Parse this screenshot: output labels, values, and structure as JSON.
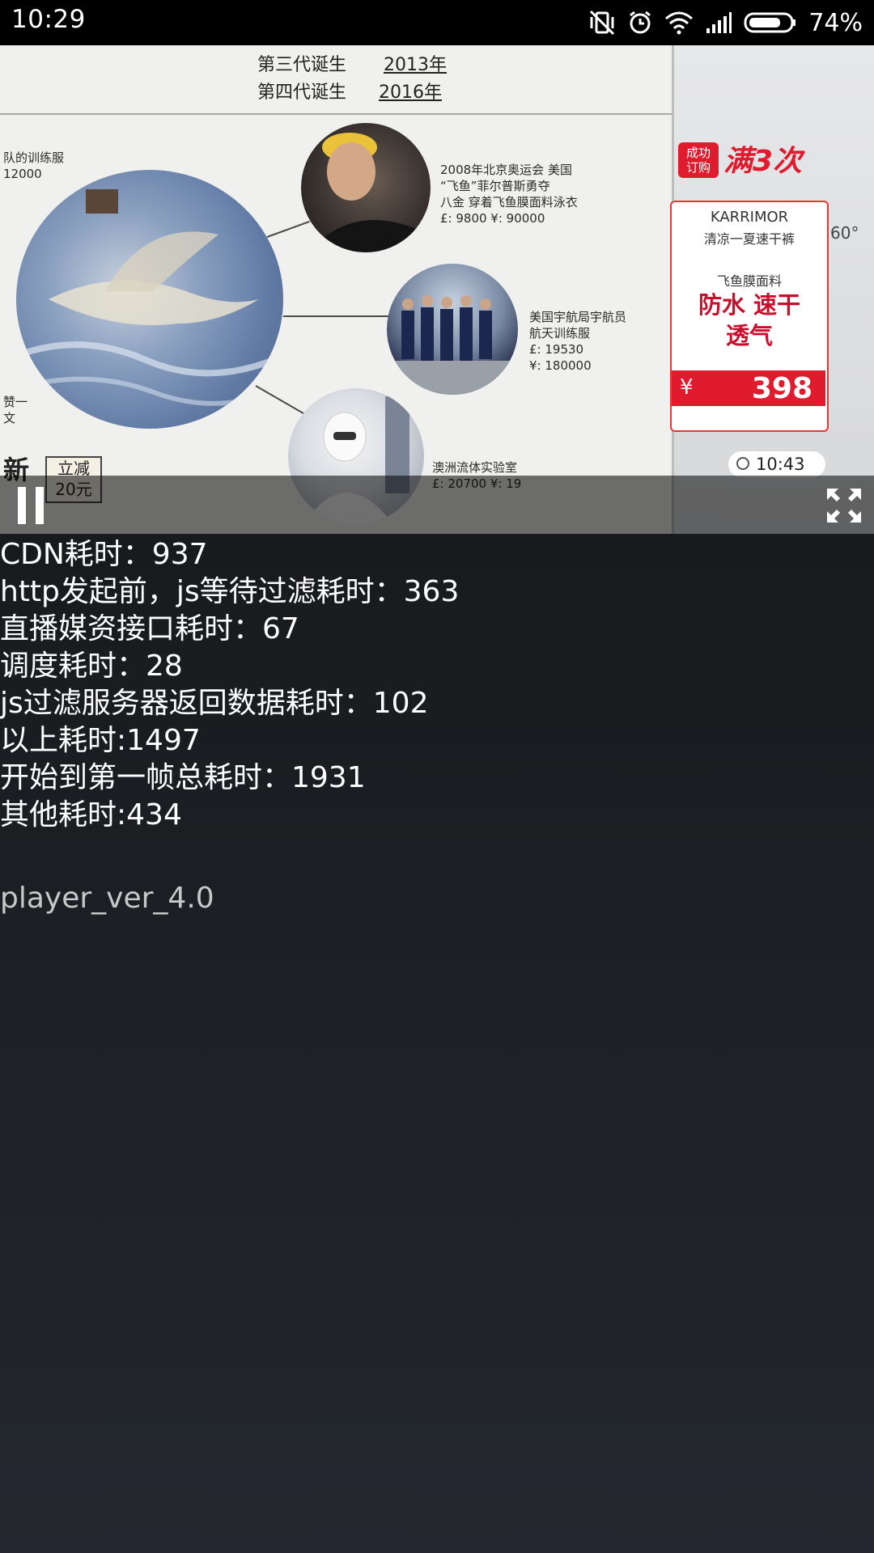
{
  "status_bar": {
    "time": "10:29",
    "battery_percent": "74%",
    "icons": [
      "vibrate-off-icon",
      "alarm-icon",
      "wifi-icon",
      "signal-icon",
      "battery-icon"
    ]
  },
  "player": {
    "board": {
      "gen3_label": "第三代诞生",
      "gen3_year": "2013年",
      "gen4_label": "第四代诞生",
      "gen4_year": "2016年",
      "left_top": "队的训练服",
      "left_price": "12000",
      "swimmer_caption": "2008年北京奥运会 美国\n“飞鱼”菲尔普斯勇夺\n八金 穿着飞鱼膜面料泳衣\n£: 9800 ¥: 90000",
      "astro_caption": "美国宇航局宇航员\n航天训练服\n£: 19530\n¥: 180000",
      "lab_caption": "澳洲流体实验室\n£: 20700 ¥: 19",
      "left_edge_a": "赞一",
      "left_edge_b": "文",
      "left_new": "新"
    },
    "ad": {
      "badge": "成功\n订购",
      "slogan": "满3次",
      "brand": "KARRIMOR",
      "subtitle": "清凉一夏速干裤",
      "material": "飞鱼膜面料",
      "features": "防水 速干\n透气",
      "currency": "¥",
      "price": "398",
      "bg_text": "60°"
    },
    "promo": "立减\n20元",
    "video_time": "10:43",
    "controls": {
      "pause_icon": "pause-icon",
      "fullscreen_icon": "fullscreen-icon"
    }
  },
  "stats": [
    "CDN耗时：937",
    "http发起前，js等待过滤耗时：363",
    "直播媒资接口耗时：67",
    "调度耗时：28",
    "js过滤服务器返回数据耗时：102",
    "以上耗时:1497",
    "开始到第一帧总耗时：1931",
    "其他耗时:434"
  ],
  "version": "player_ver_4.0"
}
